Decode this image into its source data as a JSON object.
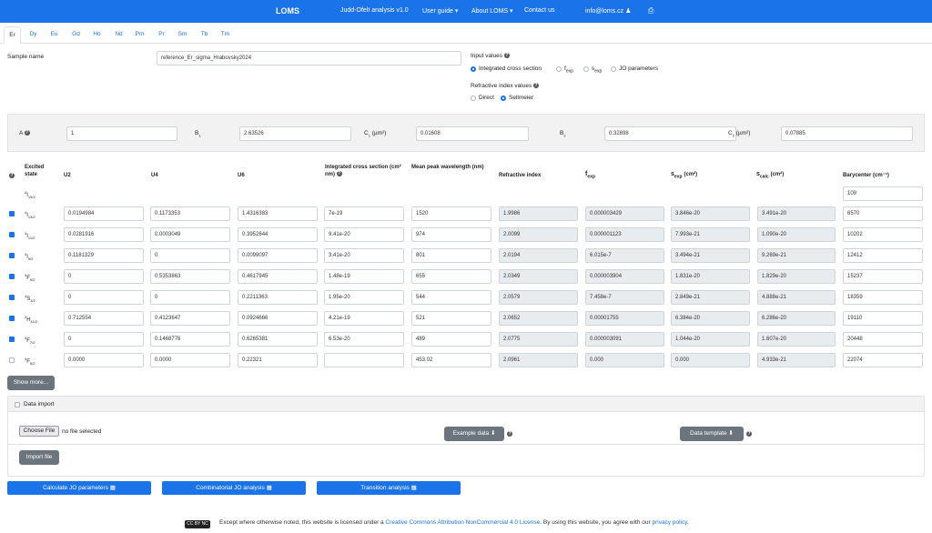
{
  "navbar": {
    "brand": "LOMS",
    "items": [
      "Judd-Ofelt analysis v1.0",
      "User guide",
      "About LOMS",
      "Contact us",
      "info@loms.cz"
    ]
  },
  "tabs": [
    "Er",
    "Dy",
    "Eu",
    "Gd",
    "Ho",
    "Nd",
    "Pm",
    "Pr",
    "Sm",
    "Tb",
    "Tm"
  ],
  "sample": {
    "label": "Sample name",
    "value": "reference_Er_sigma_Hrabovsky2024"
  },
  "input_values": {
    "title": "Input values",
    "options": [
      "Integrated cross section",
      "f",
      "s",
      "JO parameters"
    ],
    "option_subs": [
      "",
      "exp",
      "exp",
      ""
    ],
    "selected": 0
  },
  "refractive": {
    "title": "Refractive index values",
    "options": [
      "Direct",
      "Sellmeier"
    ],
    "selected": 1
  },
  "sellmeier": {
    "a_label": "A",
    "a_value": "1",
    "b1_label": "B",
    "b1_sub": "1",
    "b1_value": "2.63526",
    "c1_label": "C",
    "c1_sub": "1",
    "c1_unit": "(µm²)",
    "c1_value": "0.01608",
    "b2_label": "B",
    "b2_sub": "2",
    "b2_value": "0.32898",
    "c2_label": "C",
    "c2_sub": "2",
    "c2_unit": "(µm²)",
    "c2_value": "0.07885"
  },
  "table": {
    "headers": {
      "state": "Excited state",
      "u2": "U2",
      "u4": "U4",
      "u6": "U6",
      "ics": "Integrated cross section (cm² nm)",
      "mpw": "Mean peak wavelength (nm)",
      "ri": "Refractive index",
      "fexp": "f",
      "fexp_sub": "exp",
      "sexp": "s",
      "sexp_sub": "exp",
      "sexp_unit": "(cm²)",
      "scalc": "s",
      "scalc_sub": "calc",
      "scalc_unit": "(cm²)",
      "bary": "Barycenter (cm⁻¹)"
    },
    "ground": {
      "sup": "4",
      "letter": "I",
      "sub": "15/2",
      "barycenter": "109"
    },
    "rows": [
      {
        "checked": true,
        "sup": "4",
        "letter": "I",
        "sub": "13/2",
        "u2": "0.0194984",
        "u4": "0.1173353",
        "u6": "1.4316383",
        "ics": "7e-19",
        "mpw": "1520",
        "ri": "1.9986",
        "fexp": "0.000003429",
        "sexp": "3.846e-20",
        "scalc": "3.491e-20",
        "bary": "6570"
      },
      {
        "checked": true,
        "sup": "4",
        "letter": "I",
        "sub": "11/2",
        "u2": "0.0281916",
        "u4": "0.0003049",
        "u6": "0.3952644",
        "ics": "9.41e-20",
        "mpw": "974",
        "ri": "2.0099",
        "fexp": "0.000001123",
        "sexp": "7.993e-21",
        "scalc": "1.090e-20",
        "bary": "10202"
      },
      {
        "checked": true,
        "sup": "4",
        "letter": "I",
        "sub": "9/2",
        "u2": "0.1181329",
        "u4": "0",
        "u6": "0.0099097",
        "ics": "3.41e-20",
        "mpw": "801",
        "ri": "2.0194",
        "fexp": "6.015e-7",
        "sexp": "3.494e-21",
        "scalc": "9.269e-21",
        "bary": "12412"
      },
      {
        "checked": true,
        "sup": "4",
        "letter": "F",
        "sub": "9/2",
        "u2": "0",
        "u4": "0.5353863",
        "u6": "0.4617945",
        "ics": "1.48e-19",
        "mpw": "655",
        "ri": "2.0349",
        "fexp": "0.000003904",
        "sexp": "1.831e-20",
        "scalc": "1.829e-20",
        "bary": "15237"
      },
      {
        "checked": true,
        "sup": "4",
        "letter": "S",
        "sub": "3/2",
        "u2": "0",
        "u4": "0",
        "u6": "0.2211363",
        "ics": "1.95e-20",
        "mpw": "544",
        "ri": "2.0579",
        "fexp": "7.458e-7",
        "sexp": "2.849e-21",
        "scalc": "4.888e-21",
        "bary": "18359"
      },
      {
        "checked": true,
        "sup": "2",
        "letter": "H",
        "sub": "11/2",
        "u2": "0.712554",
        "u4": "0.4123647",
        "u6": "0.0924666",
        "ics": "4.21e-19",
        "mpw": "521",
        "ri": "2.0652",
        "fexp": "0.00001755",
        "sexp": "6.384e-20",
        "scalc": "6.286e-20",
        "bary": "19110"
      },
      {
        "checked": true,
        "sup": "4",
        "letter": "F",
        "sub": "7/2",
        "u2": "0",
        "u4": "0.1468776",
        "u6": "0.6265381",
        "ics": "6.53e-20",
        "mpw": "489",
        "ri": "2.0775",
        "fexp": "0.000003091",
        "sexp": "1.044e-20",
        "scalc": "1.607e-20",
        "bary": "20448"
      },
      {
        "checked": false,
        "sup": "4",
        "letter": "F",
        "sub": "5/2",
        "u2": "0.0000",
        "u4": "0.0000",
        "u6": "0.22321",
        "ics": "",
        "mpw": "453.02",
        "ri": "2.0961",
        "fexp": "0.000",
        "sexp": "0.000",
        "scalc": "4.933e-21",
        "bary": "22074"
      }
    ],
    "show_more": "Show more..."
  },
  "data_import": {
    "title": "Data import",
    "choose_file": "Choose File",
    "no_file": "no file selected",
    "example_data": "Example data",
    "data_template": "Data template",
    "import_file": "Import file"
  },
  "actions": [
    "Calculate JO parameters",
    "Combinatorial JO analysis",
    "Transition analysis"
  ],
  "footer": {
    "badge": "CC BY NC",
    "text1": "Except where otherwise noted, this website is licensed under a ",
    "link1": "Creative Commons Attribution NonCommercial 4.0 License",
    "text2": ". By using this website, you agree with our ",
    "link2": "privacy policy",
    "text3": "."
  },
  "colors": {
    "accent": "#1a73e8",
    "dark_button": "#6c757d",
    "panel": "#f2f2f2"
  }
}
